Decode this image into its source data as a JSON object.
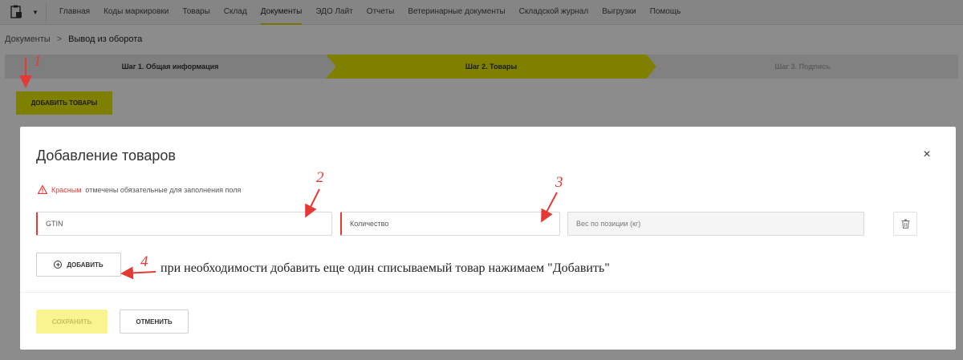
{
  "nav": {
    "items": [
      "Главная",
      "Коды маркировки",
      "Товары",
      "Склад",
      "Документы",
      "ЭДО Лайт",
      "Отчеты",
      "Ветеринарные документы",
      "Складской журнал",
      "Выгрузки",
      "Помощь"
    ],
    "active": "Документы"
  },
  "breadcrumb": {
    "parent": "Документы",
    "separator": ">",
    "current": "Вывод из оборота"
  },
  "steps": [
    "Шаг 1. Общая информация",
    "Шаг 2. Товары",
    "Шаг 3. Подпись"
  ],
  "add_goods_label": "ДОБАВИТЬ ТОВАРЫ",
  "modal": {
    "title": "Добавление товаров",
    "close": "×",
    "required_note_red": "Красным",
    "required_note_rest": "отмечены обязательные для заполнения поля",
    "fields": {
      "gtin_placeholder": "GTIN",
      "qty_placeholder": "Количество",
      "weight_placeholder": "Вес по позиции (кг)"
    },
    "add_label": "ДОБАВИТЬ",
    "save_label": "СОХРАНИТЬ",
    "cancel_label": "ОТМЕНИТЬ"
  },
  "annotation_text": "при необходимости добавить еще один списываемый товар нажимаем \"Добавить\"",
  "marks": [
    "1",
    "2",
    "3",
    "4"
  ],
  "colors": {
    "accent": "#e8e800",
    "required": "#e53935",
    "arrow": "#e53935"
  }
}
